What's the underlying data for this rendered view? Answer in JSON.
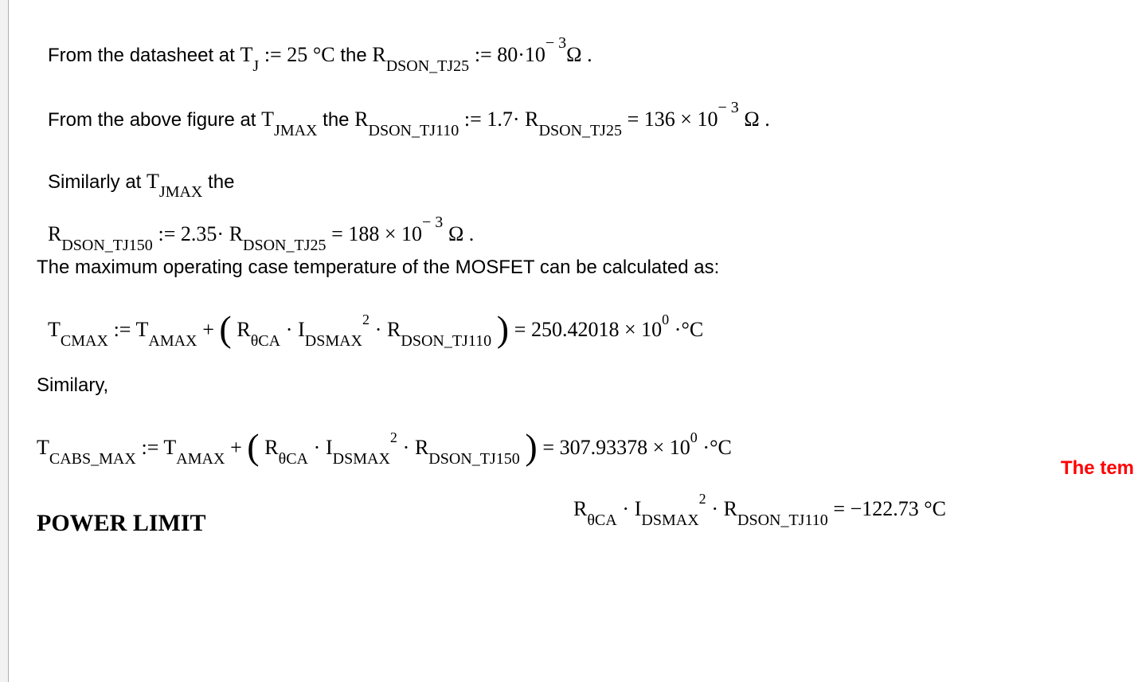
{
  "line1": {
    "prefix": "From the datasheet at ",
    "tj_var": "T",
    "tj_sub": "J",
    "assign": " := ",
    "tj_val": "25",
    "degc": "°C",
    "mid": " the ",
    "r_var": "R",
    "r_sub": "DSON_TJ25",
    "assign2": " := ",
    "r_val": "80·10",
    "r_exp": "− 3",
    "ohm": "Ω",
    "end": "."
  },
  "line2": {
    "prefix": "From the above figure at ",
    "t_var": "T",
    "t_sub": "JMAX",
    "mid": " the ",
    "r_var": "R",
    "r_sub": "DSON_TJ110",
    "assign": " := ",
    "factor": "1.7·",
    "r2_var": "R",
    "r2_sub": "DSON_TJ25",
    "eq": " = ",
    "result": "136 × 10",
    "exp": "− 3",
    "ohm": " Ω  ."
  },
  "line3": {
    "prefix": "Similarly at ",
    "t_var": "T",
    "t_sub": "JMAX",
    "suffix": " the"
  },
  "line4": {
    "r_var": "R",
    "r_sub": "DSON_TJ150",
    "assign": " := ",
    "factor": "2.35·",
    "r2_var": "R",
    "r2_sub": "DSON_TJ25",
    "eq": " = ",
    "result": "188 × 10",
    "exp": "− 3",
    "ohm": " Ω  ."
  },
  "line5": {
    "text": "The maximum operating case temperature of the MOSFET can be calculated as:"
  },
  "line6": {
    "t_var": "T",
    "t_sub": "CMAX",
    "assign": " := ",
    "t2_var": "T",
    "t2_sub": "AMAX",
    "plus": " + ",
    "lp": "(",
    "r_var": "R",
    "r_sub": "θCA",
    "mul": "·",
    "i_var": "I",
    "i_sub": "DSMAX",
    "i_sup": "2",
    "mul2": "·",
    "r2_var": "R",
    "r2_sub": "DSON_TJ110",
    "rp": ")",
    "eq": " = ",
    "result": "250.42018 × 10",
    "exp": "0",
    "unit": "·°C"
  },
  "red_note": {
    "text": "The tem"
  },
  "line7": {
    "text": "Similary,"
  },
  "line8": {
    "t_var": "T",
    "t_sub": "CABS_MAX",
    "assign": " := ",
    "t2_var": "T",
    "t2_sub": "AMAX",
    "plus": " + ",
    "lp": "(",
    "r_var": "R",
    "r_sub": "θCA",
    "mul": "·",
    "i_var": "I",
    "i_sub": "DSMAX",
    "i_sup": "2",
    "mul2": "·",
    "r2_var": "R",
    "r2_sub": "DSON_TJ150",
    "rp": ")",
    "eq": " = ",
    "result": "307.93378 × 10",
    "exp": "0",
    "unit": "·°C"
  },
  "line9": {
    "r_var": "R",
    "r_sub": "θCA",
    "mul": "·",
    "i_var": "I",
    "i_sub": "DSMAX",
    "i_sup": "2",
    "mul2": "·",
    "r2_var": "R",
    "r2_sub": "DSON_TJ110",
    "eq": " = ",
    "result": "−122.73 °C"
  },
  "heading": {
    "text": "POWER LIMIT"
  }
}
